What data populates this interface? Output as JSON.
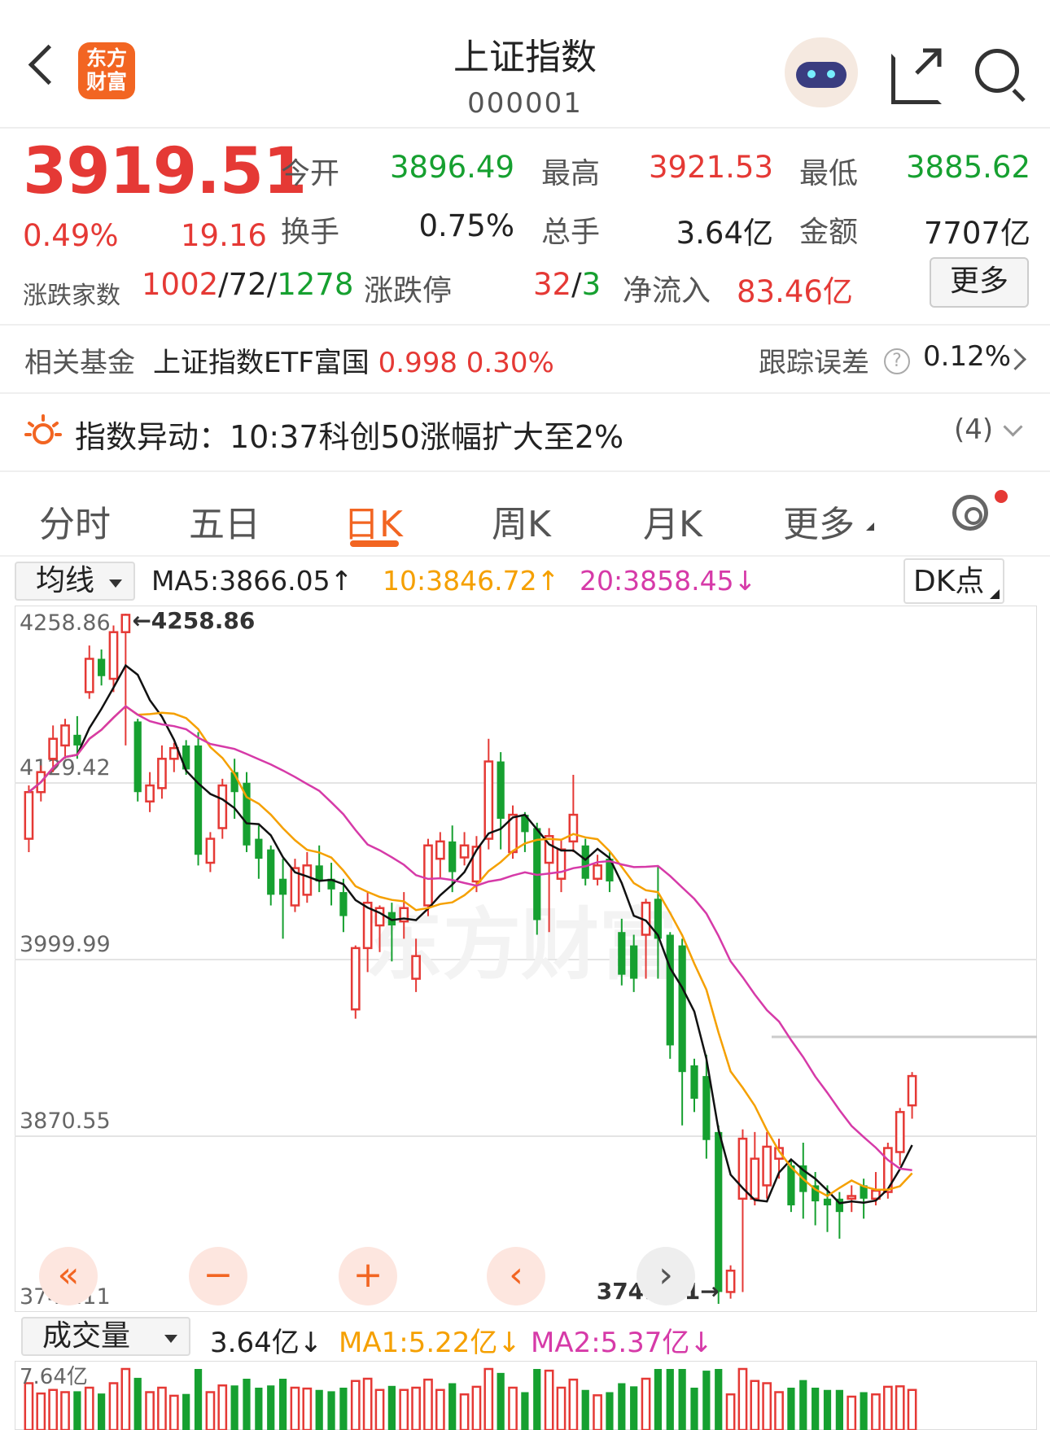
{
  "header": {
    "logo_line1": "东方",
    "logo_line2": "财富",
    "title": "上证指数",
    "code": "000001"
  },
  "quote": {
    "price": "3919.51",
    "change_pct": "0.49%",
    "change": "19.16",
    "open_label": "今开",
    "open": "3896.49",
    "high_label": "最高",
    "high": "3921.53",
    "low_label": "最低",
    "low": "3885.62",
    "turnover_label": "换手",
    "turnover": "0.75%",
    "volume_label": "总手",
    "volume": "3.64亿",
    "amount_label": "金额",
    "amount": "7707亿",
    "breadth_label": "涨跌家数",
    "breadth_up": "1002",
    "breadth_flat": "72",
    "breadth_down": "1278",
    "limit_label": "涨跌停",
    "limit_up": "32",
    "limit_down": "3",
    "netflow_label": "净流入",
    "netflow": "83.46亿",
    "more_label": "更多"
  },
  "fund": {
    "label": "相关基金",
    "name": "上证指数ETF富国",
    "price": "0.998",
    "pct": "0.30%",
    "track_label": "跟踪误差",
    "track_value": "0.12%"
  },
  "alert": {
    "text": "指数异动：10:37科创50涨幅扩大至2%",
    "count": "(4)"
  },
  "tabs": [
    {
      "label": "分时"
    },
    {
      "label": "五日"
    },
    {
      "label": "日K"
    },
    {
      "label": "周K"
    },
    {
      "label": "月K"
    },
    {
      "label": "更多"
    }
  ],
  "ma_bar": {
    "select": "均线",
    "ma5": "MA5:3866.05↑",
    "ma10": "10:3846.72↑",
    "ma20": "20:3858.45↓",
    "dk": "DK点"
  },
  "volume_bar": {
    "select": "成交量",
    "vol": "3.64亿↓",
    "ma1": "MA1:5.22亿↓",
    "ma2": "MA2:5.37亿↓",
    "axis_top": "7.64亿"
  },
  "chart_data": {
    "type": "candlestick",
    "y_ticks": [
      "4258.86",
      "4129.42",
      "3999.99",
      "3870.55",
      "3741.11"
    ],
    "ylim": [
      3741.11,
      4258.86
    ],
    "max_label": "4258.86",
    "min_label": "3741.11",
    "colors": {
      "up": "#e53935",
      "down": "#16a030",
      "ma5": "#111111",
      "ma10": "#f5a000",
      "ma20": "#d63aa8"
    },
    "candles": [
      [
        4090,
        4125,
        4080,
        4130
      ],
      [
        4125,
        4140,
        4118,
        4145
      ],
      [
        4150,
        4165,
        4140,
        4175
      ],
      [
        4160,
        4175,
        4150,
        4180
      ],
      [
        4168,
        4160,
        4150,
        4182
      ],
      [
        4200,
        4225,
        4195,
        4235
      ],
      [
        4225,
        4212,
        4205,
        4232
      ],
      [
        4210,
        4245,
        4200,
        4250
      ],
      [
        4245,
        4258,
        4160,
        4258.86
      ],
      [
        4178,
        4125,
        4118,
        4180
      ],
      [
        4118,
        4130,
        4110,
        4140
      ],
      [
        4128,
        4150,
        4120,
        4160
      ],
      [
        4150,
        4158,
        4140,
        4162
      ],
      [
        4160,
        4142,
        4138,
        4164
      ],
      [
        4160,
        4078,
        4070,
        4170
      ],
      [
        4072,
        4090,
        4065,
        4095
      ],
      [
        4098,
        4130,
        4090,
        4135
      ],
      [
        4140,
        4125,
        4105,
        4150
      ],
      [
        4132,
        4085,
        4080,
        4140
      ],
      [
        4090,
        4075,
        4060,
        4100
      ],
      [
        4082,
        4048,
        4040,
        4085
      ],
      [
        4060,
        4048,
        4015,
        4075
      ],
      [
        4040,
        4068,
        4035,
        4075
      ],
      [
        4048,
        4070,
        4042,
        4080
      ],
      [
        4070,
        4058,
        4050,
        4085
      ],
      [
        4060,
        4052,
        4040,
        4072
      ],
      [
        4050,
        4032,
        4020,
        4060
      ],
      [
        3962,
        4008,
        3955,
        4010
      ],
      [
        4008,
        4042,
        3990,
        4050
      ],
      [
        4025,
        4038,
        4005,
        4040
      ],
      [
        4035,
        4025,
        3998,
        4042
      ],
      [
        4028,
        4038,
        4015,
        4050
      ],
      [
        3985,
        4002,
        3975,
        4015
      ],
      [
        4040,
        4085,
        4032,
        4090
      ],
      [
        4075,
        4088,
        4060,
        4095
      ],
      [
        4088,
        4065,
        4050,
        4100
      ],
      [
        4076,
        4085,
        4070,
        4095
      ],
      [
        4058,
        4084,
        4050,
        4092
      ],
      [
        4090,
        4148,
        4082,
        4165
      ],
      [
        4148,
        4105,
        4082,
        4155
      ],
      [
        4080,
        4108,
        4075,
        4115
      ],
      [
        4108,
        4095,
        4080,
        4110
      ],
      [
        4098,
        4029,
        4018,
        4102
      ],
      [
        4072,
        4092,
        4020,
        4098
      ],
      [
        4060,
        4082,
        4050,
        4090
      ],
      [
        4088,
        4108,
        4080,
        4138
      ],
      [
        4085,
        4060,
        4055,
        4090
      ],
      [
        4060,
        4070,
        4055,
        4078
      ],
      [
        4075,
        4058,
        4050,
        4080
      ],
      [
        4020,
        3988,
        3980,
        4030
      ],
      [
        4010,
        3985,
        3975,
        4018
      ],
      [
        4018,
        4042,
        3985,
        4045
      ],
      [
        4045,
        4015,
        3985,
        4070
      ],
      [
        4018,
        3935,
        3925,
        4020
      ],
      [
        4010,
        3915,
        3875,
        4015
      ],
      [
        3920,
        3895,
        3885,
        3925
      ],
      [
        3912,
        3864,
        3850,
        3928
      ],
      [
        3870,
        3750,
        3741.11,
        3875
      ],
      [
        3750,
        3766,
        3745,
        3770
      ],
      [
        3820,
        3865,
        3750,
        3872
      ],
      [
        3820,
        3850,
        3815,
        3870
      ],
      [
        3830,
        3859,
        3820,
        3870
      ],
      [
        3850,
        3858,
        3835,
        3865
      ],
      [
        3845,
        3815,
        3810,
        3850
      ],
      [
        3845,
        3825,
        3805,
        3862
      ],
      [
        3830,
        3818,
        3800,
        3840
      ],
      [
        3820,
        3815,
        3795,
        3830
      ],
      [
        3820,
        3810,
        3790,
        3825
      ],
      [
        3820,
        3822,
        3810,
        3830
      ],
      [
        3830,
        3820,
        3805,
        3835
      ],
      [
        3820,
        3826,
        3815,
        3840
      ],
      [
        3825,
        3858,
        3820,
        3862
      ],
      [
        3855,
        3885,
        3845,
        3888
      ],
      [
        3890,
        3912,
        3880,
        3915
      ]
    ]
  }
}
